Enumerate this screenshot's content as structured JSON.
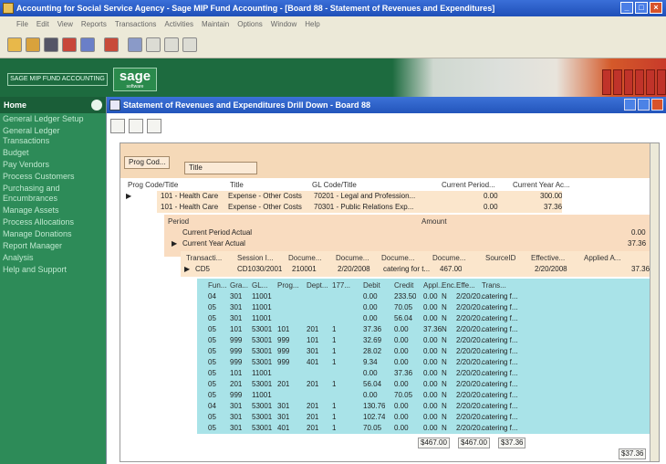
{
  "window": {
    "title": "Accounting for Social Service Agency - Sage MIP Fund Accounting - [Board 88 - Statement of Revenues and Expenditures]"
  },
  "menu": [
    "File",
    "Edit",
    "View",
    "Reports",
    "Transactions",
    "Activities",
    "Maintain",
    "Options",
    "Window",
    "Help"
  ],
  "banner": {
    "brand_box": "SAGE MIP FUND ACCOUNTING",
    "logo": "sage",
    "logo_sub": "software"
  },
  "sidebar": {
    "header": "Home",
    "items": [
      "General Ledger Setup",
      "General Ledger Transactions",
      "Budget",
      "Pay Vendors",
      "Process Customers",
      "Purchasing and Encumbrances",
      "Manage Assets",
      "Process Allocations",
      "Manage Donations",
      "Report Manager",
      "Analysis",
      "Help and Support"
    ]
  },
  "doc": {
    "title": "Statement of Revenues and Expenditures Drill Down - Board 88"
  },
  "groupbar": {
    "chip1": "Prog Cod...",
    "chip2": "Title"
  },
  "level1": {
    "headers": [
      "Prog Code/Title",
      "Title",
      "GL Code/Title",
      "Current Period...",
      "Current Year Ac..."
    ],
    "rows": [
      {
        "prog": "101 - Health Care",
        "title": "Expense - Other Costs",
        "gl": "70201 - Legal and Profession...",
        "cur": "0.00",
        "ytd": "300.00"
      },
      {
        "prog": "101 - Health Care",
        "title": "Expense - Other Costs",
        "gl": "70301 - Public Relations Exp...",
        "cur": "0.00",
        "ytd": "37.36"
      }
    ]
  },
  "level2": {
    "headers": [
      "Period",
      "Amount"
    ],
    "rows": [
      {
        "label": "Current Period Actual",
        "amount": "0.00"
      },
      {
        "label": "Current Year Actual",
        "amount": "37.36"
      }
    ]
  },
  "level3": {
    "headers": [
      "Transacti...",
      "Session I...",
      "Docume...",
      "Docume...",
      "Docume...",
      "Docume...",
      "SourceID",
      "Effective...",
      "Applied A..."
    ],
    "row": [
      "CD5",
      "CD1030/2001",
      "210001",
      "2/20/2008",
      "catering for t...",
      "467.00",
      "",
      "2/20/2008",
      "37.36"
    ]
  },
  "level4": {
    "headers": [
      "Fun...",
      "Gra...",
      "GL...",
      "Prog...",
      "Dept...",
      "177...",
      "Debit",
      "Credit",
      "Appl...",
      "Enc...",
      "Effe...",
      "Trans..."
    ],
    "rows": [
      [
        "04",
        "301",
        "11001",
        "",
        "",
        "",
        "0.00",
        "233.50",
        "0.00",
        "N",
        "2/20/20..",
        "catering f..."
      ],
      [
        "05",
        "301",
        "11001",
        "",
        "",
        "",
        "0.00",
        "70.05",
        "0.00",
        "N",
        "2/20/20..",
        "catering f..."
      ],
      [
        "05",
        "301",
        "11001",
        "",
        "",
        "",
        "0.00",
        "56.04",
        "0.00",
        "N",
        "2/20/20..",
        "catering f..."
      ],
      [
        "05",
        "101",
        "53001",
        "101",
        "201",
        "1",
        "37.36",
        "0.00",
        "37.36",
        "N",
        "2/20/20..",
        "catering f..."
      ],
      [
        "05",
        "999",
        "53001",
        "999",
        "101",
        "1",
        "32.69",
        "0.00",
        "0.00",
        "N",
        "2/20/20..",
        "catering f..."
      ],
      [
        "05",
        "999",
        "53001",
        "999",
        "301",
        "1",
        "28.02",
        "0.00",
        "0.00",
        "N",
        "2/20/20..",
        "catering f..."
      ],
      [
        "05",
        "999",
        "53001",
        "999",
        "401",
        "1",
        "9.34",
        "0.00",
        "0.00",
        "N",
        "2/20/20..",
        "catering f..."
      ],
      [
        "05",
        "101",
        "11001",
        "",
        "",
        "",
        "0.00",
        "37.36",
        "0.00",
        "N",
        "2/20/20..",
        "catering f..."
      ],
      [
        "05",
        "201",
        "53001",
        "201",
        "201",
        "1",
        "56.04",
        "0.00",
        "0.00",
        "N",
        "2/20/20..",
        "catering f..."
      ],
      [
        "05",
        "999",
        "11001",
        "",
        "",
        "",
        "0.00",
        "70.05",
        "0.00",
        "N",
        "2/20/20..",
        "catering f..."
      ],
      [
        "04",
        "301",
        "53001",
        "301",
        "201",
        "1",
        "130.76",
        "0.00",
        "0.00",
        "N",
        "2/20/20..",
        "catering f..."
      ],
      [
        "05",
        "301",
        "53001",
        "301",
        "201",
        "1",
        "102.74",
        "0.00",
        "0.00",
        "N",
        "2/20/20..",
        "catering f..."
      ],
      [
        "05",
        "301",
        "53001",
        "401",
        "201",
        "1",
        "70.05",
        "0.00",
        "0.00",
        "N",
        "2/20/20..",
        "catering f..."
      ]
    ],
    "totals": [
      "$467.00",
      "$467.00",
      "$37.36"
    ]
  },
  "footer": {
    "total": "$37.36"
  }
}
